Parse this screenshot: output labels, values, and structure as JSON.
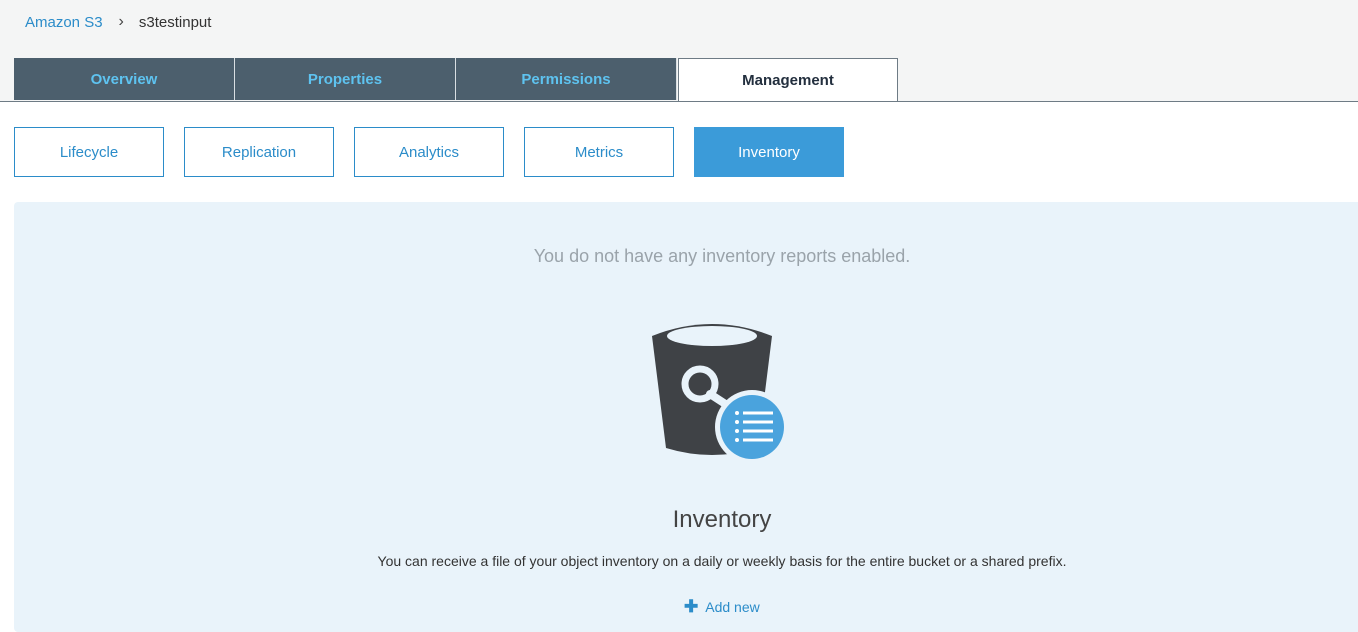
{
  "breadcrumb": {
    "root": "Amazon S3",
    "separator": "›",
    "current": "s3testinput"
  },
  "tabs": [
    {
      "label": "Overview",
      "active": false
    },
    {
      "label": "Properties",
      "active": false
    },
    {
      "label": "Permissions",
      "active": false
    },
    {
      "label": "Management",
      "active": true
    }
  ],
  "subtabs": [
    {
      "label": "Lifecycle",
      "active": false
    },
    {
      "label": "Replication",
      "active": false
    },
    {
      "label": "Analytics",
      "active": false
    },
    {
      "label": "Metrics",
      "active": false
    },
    {
      "label": "Inventory",
      "active": true
    }
  ],
  "panel": {
    "empty_message": "You do not have any inventory reports enabled.",
    "icon": "bucket-inventory-icon",
    "title": "Inventory",
    "description": "You can receive a file of your object inventory on a daily or weekly basis for the entire bucket or a shared prefix.",
    "add_icon": "plus-icon",
    "add_label": "Add new"
  },
  "colors": {
    "link": "#2b8cc9",
    "tab_bg": "#4c5f6d",
    "tab_text": "#5ec3f0",
    "subtab_active": "#3b9bd9",
    "panel_bg": "#e9f3fa"
  }
}
